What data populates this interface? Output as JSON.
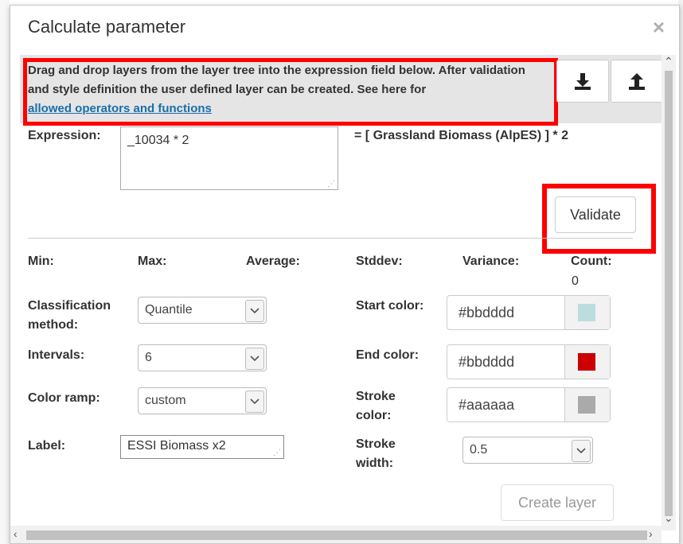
{
  "dialog": {
    "title": "Calculate parameter",
    "close_label": "×"
  },
  "info": {
    "text": "Drag and drop layers from the layer tree into the expression field below. After validation and style definition the user defined layer can be created. See here for",
    "link": "allowed operators and functions"
  },
  "toolbar": {
    "download_icon": "download-icon",
    "upload_icon": "upload-icon"
  },
  "expression": {
    "label": "Expression:",
    "value": "_10034 * 2",
    "resolved": "= [ Grassland Biomass (AlpES) ] * 2"
  },
  "validate_label": "Validate",
  "stats": {
    "min_label": "Min:",
    "max_label": "Max:",
    "average_label": "Average:",
    "stddev_label": "Stddev:",
    "variance_label": "Variance:",
    "count_label": "Count:",
    "count_value": "0"
  },
  "classification": {
    "label_line1": "Classification",
    "label_line2": "method:",
    "value": "Quantile"
  },
  "intervals": {
    "label": "Intervals:",
    "value": "6"
  },
  "color_ramp": {
    "label": "Color ramp:",
    "value": "custom"
  },
  "layer_label": {
    "label": "Label:",
    "value": "ESSI Biomass x2"
  },
  "start_color": {
    "label": "Start color:",
    "hex": "#bbdddd",
    "swatch": "#bbdddd"
  },
  "end_color": {
    "label": "End color:",
    "hex": "#bbdddd",
    "swatch": "#cc0000"
  },
  "stroke_color": {
    "label_line1": "Stroke",
    "label_line2": "color:",
    "hex": "#aaaaaa",
    "swatch": "#aaaaaa"
  },
  "stroke_width": {
    "label_line1": "Stroke",
    "label_line2": "width:",
    "value": "0.5"
  },
  "create_layer_label": "Create layer",
  "highlight_color": "#ff0000"
}
